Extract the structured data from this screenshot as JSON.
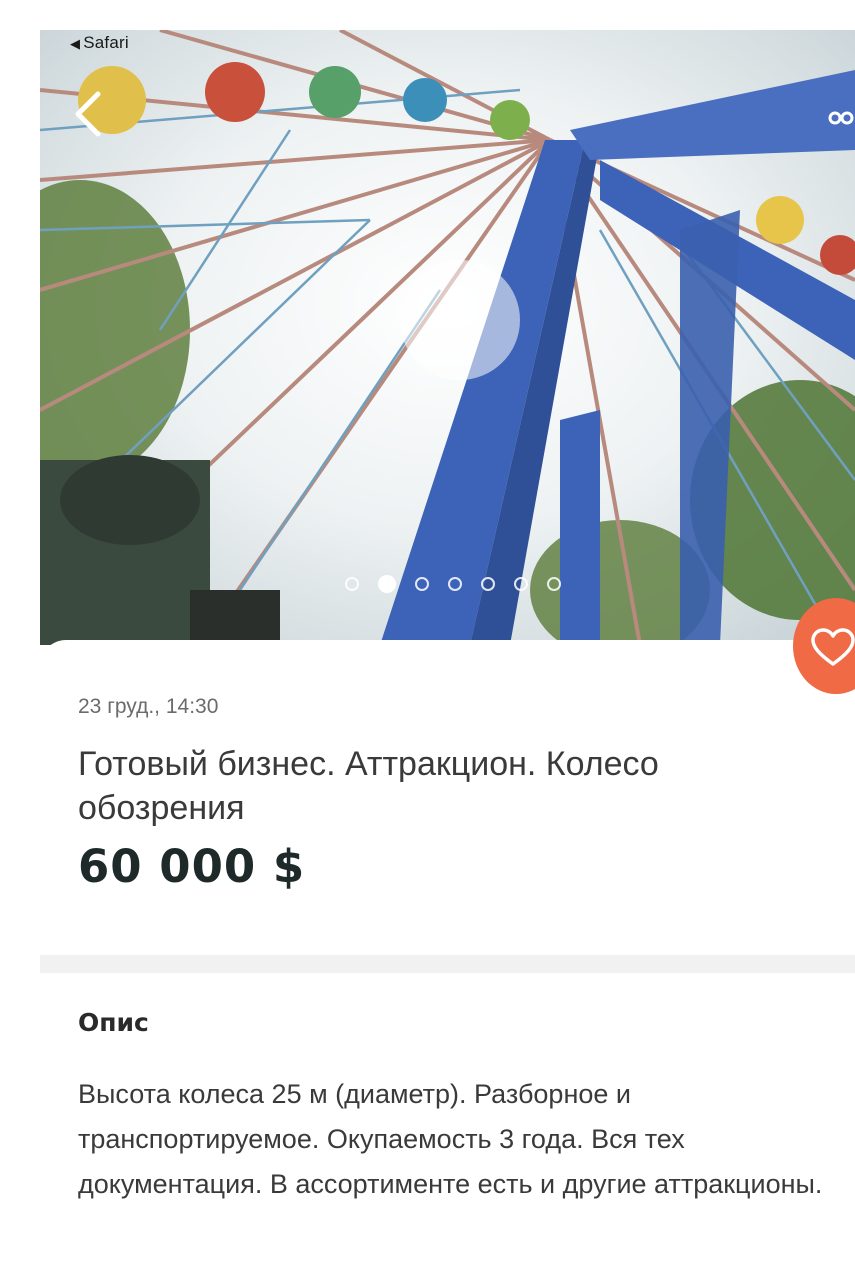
{
  "status_bar": {
    "back_app": "Safari"
  },
  "gallery": {
    "total_dots": 7,
    "active_index": 1
  },
  "listing": {
    "date": "23 груд., 14:30",
    "title": "Готовый бизнес. Аттракцион. Колесо обозрения",
    "price": "60 000 $"
  },
  "description": {
    "heading": "Опис",
    "text": "Высота колеса 25 м (диаметр). Разборное и транспортируемое. Окупаемость 3 года. Вся тех документация. В ассортименте есть и другие аттракционы."
  },
  "icons": {
    "back": "chevron-left-icon",
    "share": "share-icon",
    "favorite": "heart-icon"
  },
  "colors": {
    "accent": "#ef6a45",
    "price": "#1e2a2a",
    "frame_blue": "#3d63b8"
  }
}
